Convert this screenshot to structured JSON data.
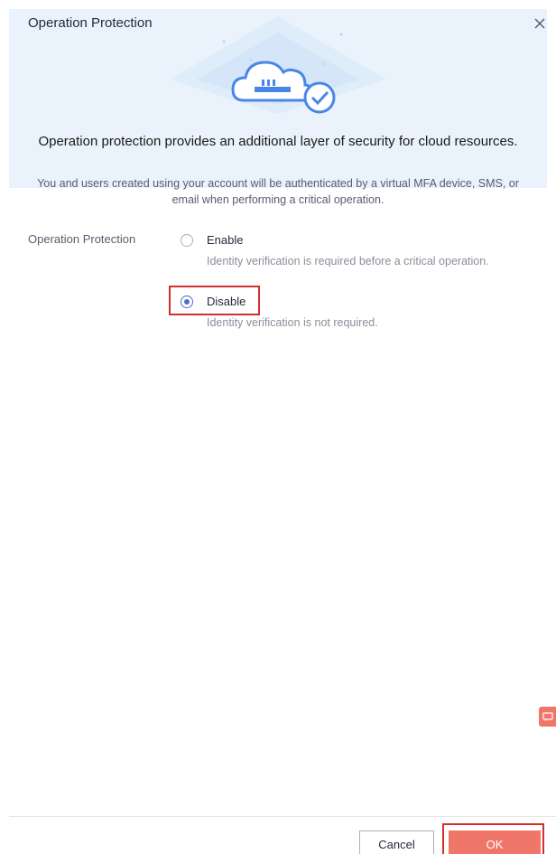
{
  "dialog": {
    "title": "Operation Protection",
    "close_icon": "close-icon",
    "hero_title": "Operation protection provides an additional layer of security for cloud resources.",
    "hero_description": "You and users created using your account will be authenticated by a virtual MFA device, SMS, or email when performing a critical operation.",
    "illustration_icon": "cloud-shield-icon"
  },
  "form": {
    "field_label": "Operation Protection",
    "options": [
      {
        "label": "Enable",
        "hint": "Identity verification is required before a critical operation.",
        "selected": false
      },
      {
        "label": "Disable",
        "hint": "Identity verification is not required.",
        "selected": true
      }
    ]
  },
  "footer": {
    "cancel_label": "Cancel",
    "ok_label": "OK"
  },
  "colors": {
    "accent": "#526ecc",
    "ok_button": "#f0766a",
    "highlight_border": "#d32f2f",
    "hero_bg": "#eaf3fc"
  }
}
